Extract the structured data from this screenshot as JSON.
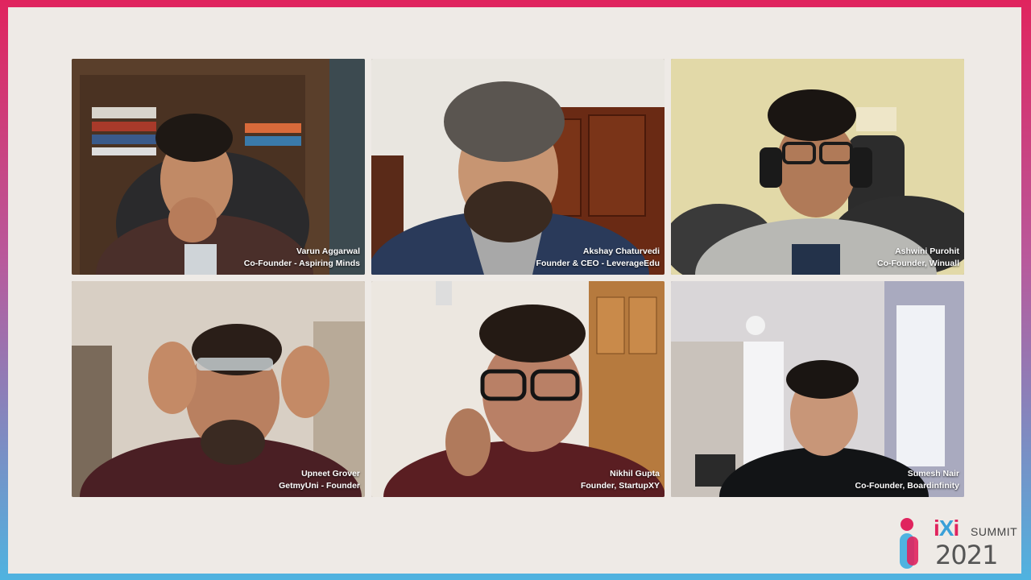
{
  "participants": [
    {
      "name": "Varun Aggarwal",
      "role": "Co-Founder - Aspiring Minds"
    },
    {
      "name": "Akshay Chaturvedi",
      "role": "Founder & CEO - LeverageEdu"
    },
    {
      "name": "Ashwini Purohit",
      "role": "Co-Founder, Winuall"
    },
    {
      "name": "Upneet Grover",
      "role": "GetmyUni - Founder"
    },
    {
      "name": "Nikhil Gupta",
      "role": "Founder, StartupXY"
    },
    {
      "name": "Sumesh Nair",
      "role": "Co-Founder, Boardinfinity"
    }
  ],
  "logo": {
    "brand_i": "i",
    "brand_x": "X",
    "brand_i2": "i",
    "summit": "SUMMIT",
    "year": "2021"
  },
  "colors": {
    "border_top": "#e0245e",
    "border_bottom": "#4fb3e0",
    "stage": "#eeeae6"
  }
}
